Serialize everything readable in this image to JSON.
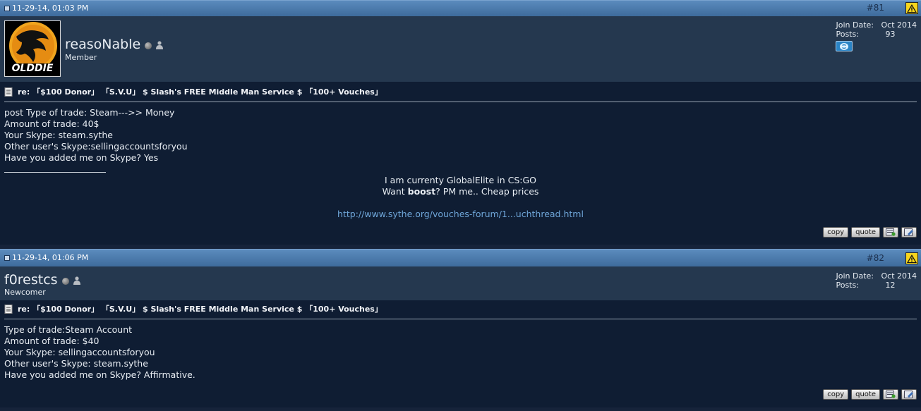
{
  "posts": [
    {
      "date": "11-29-14, 01:03 PM",
      "number": "#81",
      "username": "reasoNable",
      "user_title": "Member",
      "avatar_text": "OLDDIE",
      "join_label": "Join Date:",
      "join_value": "Oct 2014",
      "posts_label": "Posts:",
      "posts_value": "93",
      "title": "re: 「$100 Donor」 「S.V.U」 $ Slash's FREE Middle Man Service $ 「100+ Vouches」",
      "message_lines": [
        "post Type of trade: Steam--->> Money",
        "Amount of trade: 40$",
        "Your Skype: steam.sythe",
        "Other user's Skype:sellingaccountsforyou",
        "Have you added me on Skype? Yes"
      ],
      "signature": {
        "line1": "I am currenty GlobalElite in CS:GO",
        "line2_pre": "Want ",
        "line2_bold": "boost",
        "line2_post": "? PM me.. Cheap prices",
        "link": "http://www.sythe.org/vouches-forum/1...uchthread.html"
      },
      "buttons": {
        "copy": "copy",
        "quote": "quote"
      }
    },
    {
      "date": "11-29-14, 01:06 PM",
      "number": "#82",
      "username": "f0restcs",
      "user_title": "Newcomer",
      "join_label": "Join Date:",
      "join_value": "Oct 2014",
      "posts_label": "Posts:",
      "posts_value": "12",
      "title": "re: 「$100 Donor」 「S.V.U」 $ Slash's FREE Middle Man Service $ 「100+ Vouches」",
      "message_lines": [
        "Type of trade:Steam Account",
        "Amount of trade: $40",
        "Your Skype: sellingaccountsforyou",
        "Other user's Skype: steam.sythe",
        "Have you added me on Skype? Affirmative."
      ],
      "buttons": {
        "copy": "copy",
        "quote": "quote"
      }
    }
  ],
  "icons": {
    "warn": "warning-icon",
    "doc": "document-icon",
    "status": "offline-status-icon",
    "skype": "skype-icon",
    "multiquote": "multiquote-icon",
    "edit": "edit-icon"
  },
  "colors": {
    "header": "#4a78aa",
    "userbar": "#25384f",
    "body": "#0f1d33",
    "link": "#6fa6d9",
    "warn": "#f7d51d"
  }
}
